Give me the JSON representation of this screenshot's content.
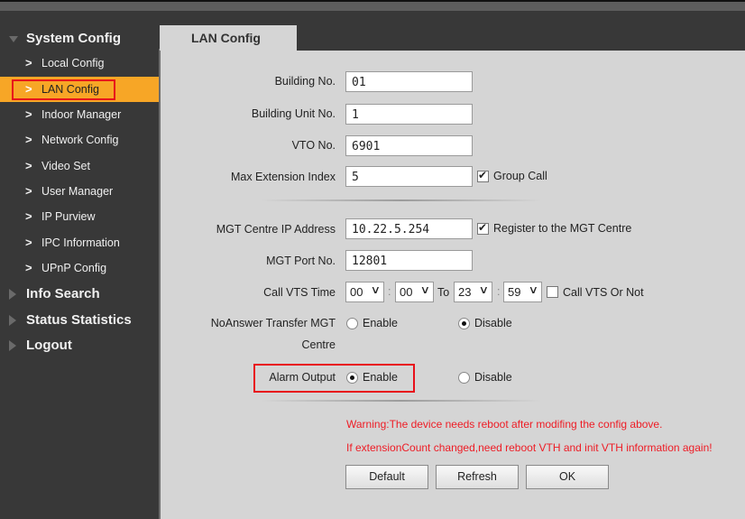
{
  "sidebar": {
    "groups": [
      {
        "label": "System Config",
        "expanded": true,
        "icon": "triangle-down-icon"
      },
      {
        "label": "Info Search",
        "expanded": false,
        "icon": "triangle-right-icon"
      },
      {
        "label": "Status Statistics",
        "expanded": false,
        "icon": "triangle-right-icon"
      },
      {
        "label": "Logout",
        "expanded": false,
        "icon": "triangle-right-icon"
      }
    ],
    "items": [
      {
        "label": "Local Config",
        "active": false
      },
      {
        "label": "LAN Config",
        "active": true
      },
      {
        "label": "Indoor Manager",
        "active": false
      },
      {
        "label": "Network Config",
        "active": false
      },
      {
        "label": "Video Set",
        "active": false
      },
      {
        "label": "User Manager",
        "active": false
      },
      {
        "label": "IP Purview",
        "active": false
      },
      {
        "label": "IPC Information",
        "active": false
      },
      {
        "label": "UPnP Config",
        "active": false
      }
    ],
    "chevron": ">"
  },
  "tab": {
    "label": "LAN Config"
  },
  "form": {
    "building_no": {
      "label": "Building No.",
      "value": "01"
    },
    "building_unit_no": {
      "label": "Building Unit No.",
      "value": "1"
    },
    "vto_no": {
      "label": "VTO No.",
      "value": "6901"
    },
    "max_extension_index": {
      "label": "Max Extension Index",
      "value": "5"
    },
    "group_call": {
      "label": "Group Call",
      "checked": true
    },
    "mgt_ip": {
      "label": "MGT Centre IP Address",
      "value": "10.22.5.254"
    },
    "register_mgt": {
      "label": "Register to the MGT Centre",
      "checked": true
    },
    "mgt_port": {
      "label": "MGT Port No.",
      "value": "12801"
    },
    "call_vts_time": {
      "label": "Call VTS Time",
      "from_hour": "00",
      "from_min": "00",
      "to_label": "To",
      "to_hour": "23",
      "to_min": "59",
      "colon": ":"
    },
    "call_vts_or_not": {
      "label": "Call VTS Or Not",
      "checked": false
    },
    "noanswer_transfer": {
      "label_line1": "NoAnswer Transfer MGT",
      "label_line2": "Centre",
      "enable_label": "Enable",
      "disable_label": "Disable",
      "selected": "Disable"
    },
    "alarm_output": {
      "label": "Alarm Output",
      "enable_label": "Enable",
      "disable_label": "Disable",
      "selected": "Enable"
    }
  },
  "warnings": [
    "Warning:The device needs reboot after modifing the config above.",
    "If extensionCount changed,need reboot VTH and init VTH information again!"
  ],
  "buttons": {
    "default": "Default",
    "refresh": "Refresh",
    "ok": "OK"
  },
  "colors": {
    "accent": "#f7a626",
    "highlight_box": "#e8101a",
    "warning": "#ee1c25"
  }
}
